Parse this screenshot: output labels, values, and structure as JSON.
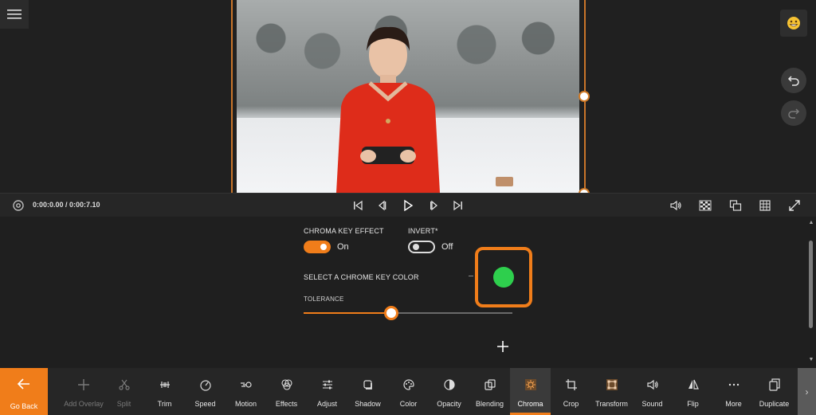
{
  "preview": {
    "menu_icon": "hamburger-menu-icon",
    "emoji_icon": "emoji-face-icon",
    "undo_icon": "undo-icon",
    "redo_icon": "redo-icon"
  },
  "playback": {
    "time": "0:00:0.00 / 0:00:7.10",
    "icons": [
      "settings-icon",
      "skip-to-start-icon",
      "previous-frame-icon",
      "play-icon",
      "next-frame-icon",
      "skip-to-end-icon",
      "volume-icon",
      "checkerboard-icon",
      "aspect-ratio-icon",
      "grid-icon",
      "fullscreen-icon"
    ]
  },
  "chroma": {
    "effect_label": "CHROMA KEY EFFECT",
    "effect_value": "On",
    "invert_label": "INVERT*",
    "invert_value": "Off",
    "color_label": "SELECT A CHROME KEY COLOR",
    "selected_color": "#2ecf4d",
    "tolerance_label": "TOLERANCE",
    "tolerance_value": 0.42
  },
  "toolbar": {
    "go_back": "Go Back",
    "items": [
      {
        "label": "Add Overlay",
        "icon": "plus-icon",
        "enabled": false
      },
      {
        "label": "Split",
        "icon": "scissors-icon",
        "enabled": false
      },
      {
        "label": "Trim",
        "icon": "trim-icon",
        "enabled": true
      },
      {
        "label": "Speed",
        "icon": "speedometer-icon",
        "enabled": true
      },
      {
        "label": "Motion",
        "icon": "motion-icon",
        "enabled": true
      },
      {
        "label": "Effects",
        "icon": "effects-icon",
        "enabled": true
      },
      {
        "label": "Adjust",
        "icon": "sliders-icon",
        "enabled": true
      },
      {
        "label": "Shadow",
        "icon": "shadow-icon",
        "enabled": true
      },
      {
        "label": "Color",
        "icon": "palette-icon",
        "enabled": true
      },
      {
        "label": "Opacity",
        "icon": "opacity-icon",
        "enabled": true
      },
      {
        "label": "Blending",
        "icon": "blending-icon",
        "enabled": true
      },
      {
        "label": "Chroma",
        "icon": "chroma-icon",
        "enabled": true,
        "active": true
      },
      {
        "label": "Crop",
        "icon": "crop-icon",
        "enabled": true
      },
      {
        "label": "Transform",
        "icon": "transform-icon",
        "enabled": true
      },
      {
        "label": "Sound",
        "icon": "sound-icon",
        "enabled": true
      },
      {
        "label": "Flip",
        "icon": "flip-icon",
        "enabled": true
      },
      {
        "label": "More",
        "icon": "more-icon",
        "enabled": true
      },
      {
        "label": "Duplicate",
        "icon": "duplicate-icon",
        "enabled": true
      }
    ]
  },
  "colors": {
    "accent": "#f07d1a",
    "background": "#1f1f1f",
    "toolbar": "#262626"
  }
}
